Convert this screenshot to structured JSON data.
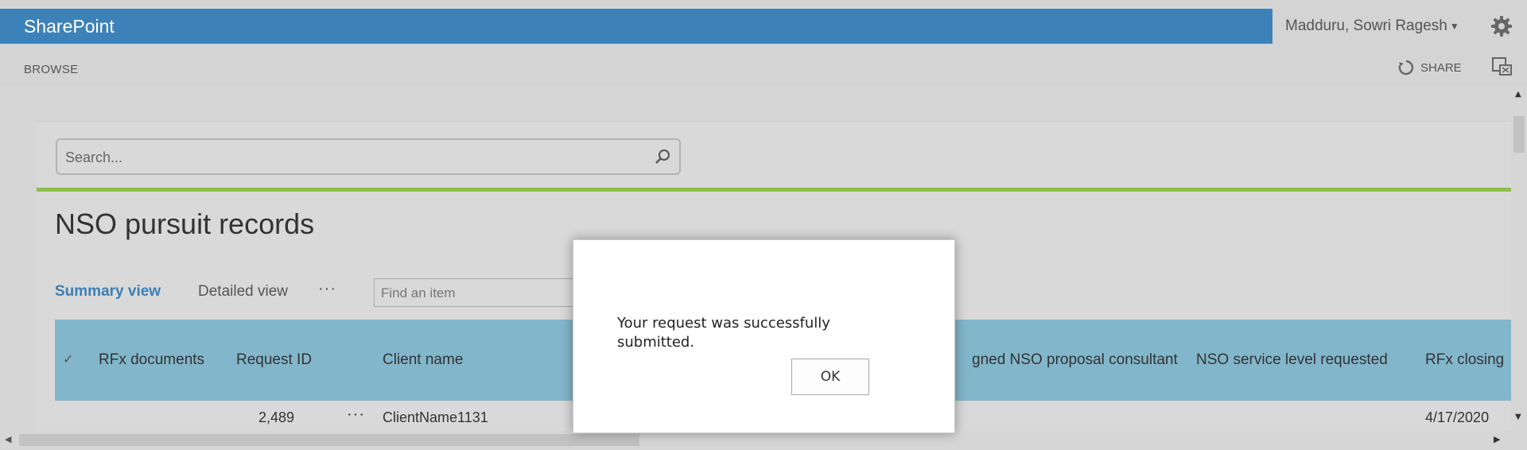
{
  "colors": {
    "suitebar": "#3c82b8",
    "accent_green": "#8bc145",
    "table_header": "#82b6cb",
    "link_blue": "#3b7fb5"
  },
  "suitebar": {
    "brand": "SharePoint",
    "user_name": "Madduru, Sowri Ragesh",
    "settings_icon": "gear-icon"
  },
  "ribbon": {
    "browse_tab": "BROWSE",
    "share_label": "SHARE",
    "share_icon": "sync-icon",
    "focus_icon": "focus-on-content-icon"
  },
  "search": {
    "placeholder": "Search...",
    "icon": "search-icon"
  },
  "page": {
    "title": "NSO pursuit records"
  },
  "views": {
    "summary": "Summary view",
    "detailed": "Detailed view",
    "more": "···",
    "find_placeholder": "Find an item"
  },
  "table": {
    "check_glyph": "✓",
    "columns": [
      "RFx documents",
      "Request ID",
      "Client name",
      "gned NSO proposal consultant",
      "NSO service level requested",
      "RFx closing"
    ],
    "rows": [
      {
        "request_id": "2,489",
        "menu": "···",
        "client_name": "ClientName1131",
        "rfx_closing": "4/17/2020"
      }
    ]
  },
  "dialog": {
    "message": "Your request was successfully submitted.",
    "ok_label": "OK"
  }
}
